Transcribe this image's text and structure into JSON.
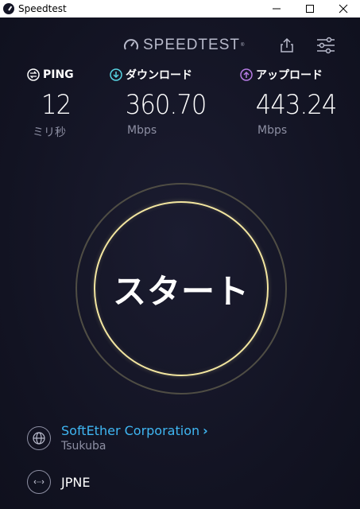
{
  "window": {
    "title": "Speedtest",
    "controls": [
      "minimize",
      "maximize",
      "close"
    ]
  },
  "header": {
    "brand": "SPEEDTEST",
    "brand_mark": "®",
    "icons": [
      "share-icon",
      "settings-sliders-icon"
    ]
  },
  "metrics": {
    "ping": {
      "label": "PING",
      "value": "12",
      "unit": "ミリ秒",
      "icon": "ping-icon"
    },
    "download": {
      "label": "ダウンロード",
      "value": "360.70",
      "unit": "Mbps",
      "icon": "download-arrow-icon",
      "color": "#58d3e2"
    },
    "upload": {
      "label": "アップロード",
      "value": "443.24",
      "unit": "Mbps",
      "icon": "upload-arrow-icon",
      "color": "#b57be3"
    }
  },
  "start": {
    "label": "スタート"
  },
  "isp": {
    "name": "SoftEther Corporation",
    "location": "Tsukuba",
    "icon": "globe-icon"
  },
  "server": {
    "name": "JPNE",
    "icon": "server-connection-icon"
  },
  "colors": {
    "background": "#141526",
    "ring": "#f3e6a0",
    "isp_link": "#3fb6f2"
  }
}
